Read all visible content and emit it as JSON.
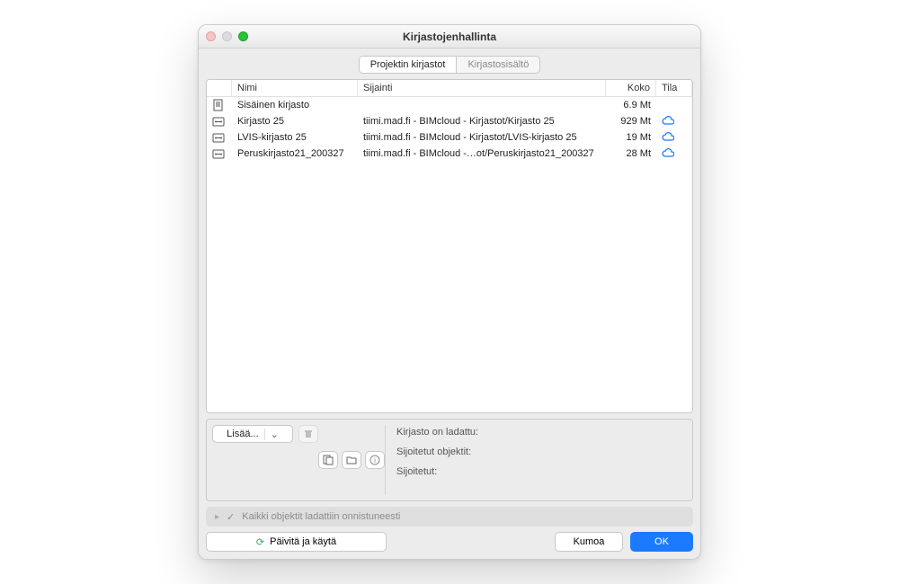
{
  "window_title": "Kirjastojenhallinta",
  "tabs": {
    "projects": "Projektin kirjastot",
    "content": "Kirjastosisältö"
  },
  "columns": {
    "name": "Nimi",
    "location": "Sijainti",
    "size": "Koko",
    "status": "Tila"
  },
  "rows": [
    {
      "icon": "file",
      "name": "Sisäinen kirjasto",
      "location": "",
      "size": "6.9 Mt",
      "cloud": false
    },
    {
      "icon": "cloud",
      "name": "Kirjasto 25",
      "location": "tiimi.mad.fi - BIMcloud - Kirjastot/Kirjasto 25",
      "size": "929 Mt",
      "cloud": true
    },
    {
      "icon": "cloud",
      "name": "LVIS-kirjasto 25",
      "location": "tiimi.mad.fi - BIMcloud - Kirjastot/LVIS-kirjasto 25",
      "size": "19 Mt",
      "cloud": true
    },
    {
      "icon": "cloud",
      "name": "Peruskirjasto21_200327",
      "location": "tiimi.mad.fi - BIMcloud -…ot/Peruskirjasto21_200327",
      "size": "28 Mt",
      "cloud": true
    }
  ],
  "add_button": "Lisää...",
  "info": {
    "loaded_label": "Kirjasto on ladattu:",
    "placed_objects_label": "Sijoitetut objektit:",
    "placed_label": "Sijoitetut:"
  },
  "status_message": "Kaikki objektit ladattiin onnistuneesti",
  "buttons": {
    "refresh": "Päivitä ja käytä",
    "cancel": "Kumoa",
    "ok": "OK"
  }
}
